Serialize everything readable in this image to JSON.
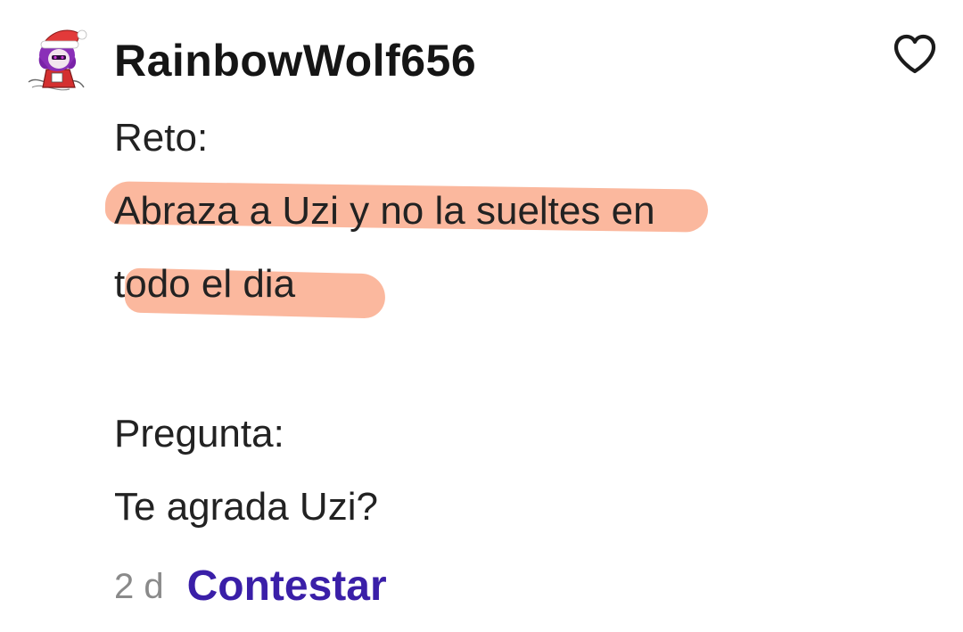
{
  "comment": {
    "username": "RainbowWolf656",
    "lines": [
      "Reto:",
      "Abraza a Uzi y no la sueltes en",
      "todo el dia",
      "Pregunta:",
      "Te agrada Uzi?"
    ],
    "time_ago": "2 d",
    "reply_label": "Contestar",
    "like_icon": "heart-outline-icon",
    "avatar_icon": "avatar-santa-hat-icon"
  },
  "colors": {
    "reply_link": "#3a1fa8",
    "highlight": "#fa9c78",
    "time_ago": "#8a8a8a",
    "text": "#222222"
  }
}
